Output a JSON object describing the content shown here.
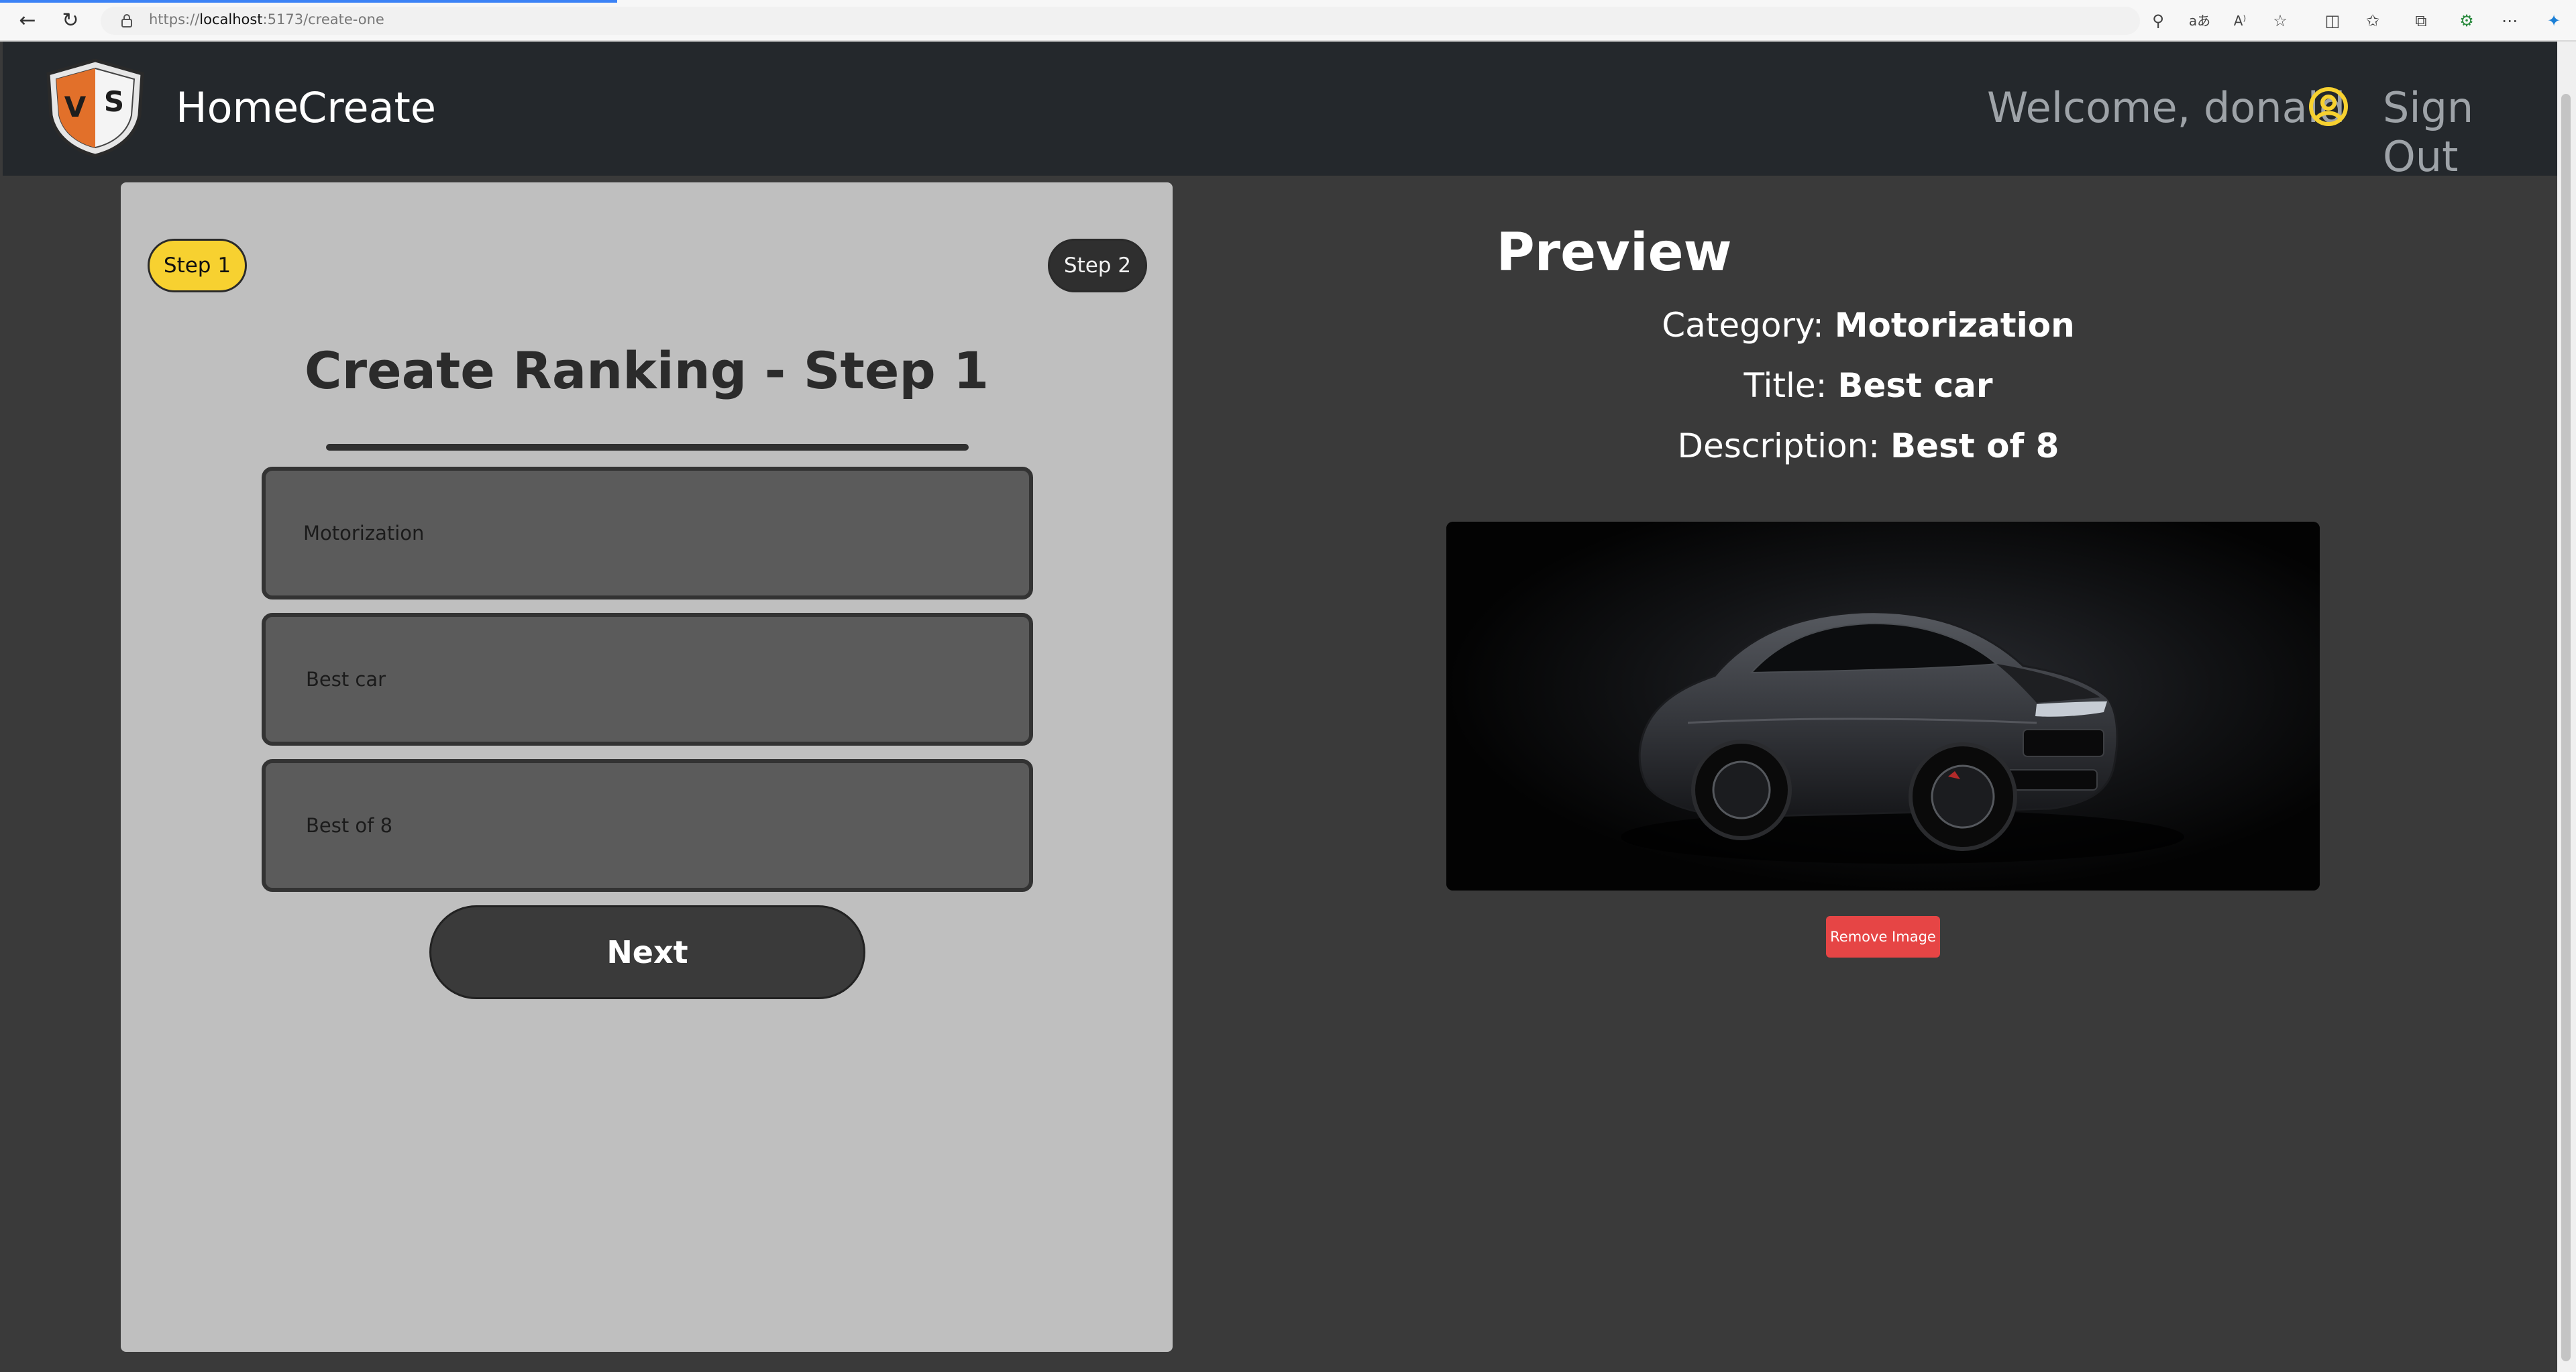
{
  "browser": {
    "url_prefix": "https://",
    "url_host": "localhost",
    "url_rest": ":5173/create-one"
  },
  "header": {
    "nav": [
      {
        "label": "Home"
      },
      {
        "label": "Create"
      }
    ],
    "welcome": "Welcome, donald",
    "sign_out": "Sign Out",
    "logo_letters": [
      "V",
      "S"
    ]
  },
  "form": {
    "step1": "Step 1",
    "step2": "Step 2",
    "title": "Create Ranking - Step 1",
    "category_value": "Motorization",
    "title_value": "Best car",
    "description_value": "Best of 8",
    "next_label": "Next"
  },
  "preview": {
    "heading": "Preview",
    "category_label": "Category: ",
    "category_value": "Motorization",
    "title_label": "Title: ",
    "title_value": "Best car",
    "description_label": "Description: ",
    "description_value": "Best of 8",
    "remove_label": "Remove Image"
  },
  "colors": {
    "header_bg": "#24282c",
    "page_bg": "#3a3a3a",
    "panel_bg": "#bfbfbf",
    "step_active": "#f7d130",
    "remove_button": "#e64545",
    "user_icon": "#f7d130"
  },
  "icons": [
    "back-icon",
    "refresh-icon",
    "lock-icon",
    "read-aloud-icon",
    "favorite-icon",
    "split-screen-icon",
    "favorites-icon",
    "collections-icon",
    "extensions-icon",
    "more-icon",
    "copilot-icon",
    "user-icon"
  ]
}
